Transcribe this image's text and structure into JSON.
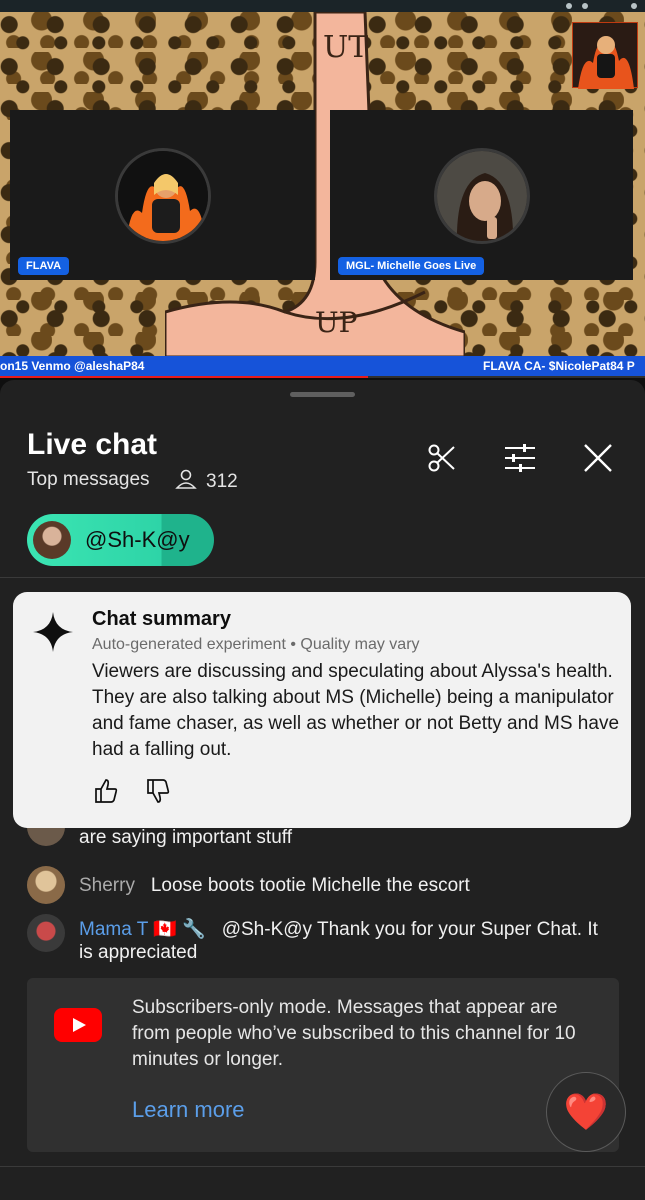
{
  "video": {
    "tiles": [
      {
        "name": "FLAVA"
      },
      {
        "name": "MGL- Michelle Goes Live"
      }
    ],
    "hand_text": {
      "top": "UT",
      "bottom": "UP"
    },
    "ticker_left": "on15 Venmo @aleshaP84",
    "ticker_right": "FLAVA CA- $NicolePat84 P",
    "progress_fraction": 0.57
  },
  "live_chat": {
    "title": "Live chat",
    "filter": "Top messages",
    "viewer_count": "312",
    "icons": [
      "scissors-icon",
      "sliders-icon",
      "close-icon"
    ]
  },
  "pinned": {
    "handle": "@Sh-K@y"
  },
  "summary": {
    "title": "Chat summary",
    "note": "Auto-generated experiment • Quality may vary",
    "body": "Viewers are discussing and speculating about Alyssa's health. They are also talking about MS (Michelle) being a manipulator and fame chaser, as well as whether or not Betty and MS have had a falling out."
  },
  "messages": [
    {
      "author": "",
      "text": "are saying important stuff"
    },
    {
      "author": "Sherry",
      "text": "Loose boots tootie Michelle the escort"
    },
    {
      "author": "Mama T",
      "badges": "🇨🇦 🔧",
      "text": "@Sh-K@y Thank you for your Super Chat. It is appreciated"
    }
  ],
  "notice": {
    "text": "Subscribers-only mode. Messages that appear are from people who’ve subscribed to this channel for 10 minutes or longer.",
    "link": "Learn more"
  },
  "reaction": {
    "emoji": "❤️"
  },
  "colors": {
    "accent": "#3be5b3",
    "link": "#5b9ee9",
    "live_red": "#ff0000",
    "ticker": "#1653d9"
  }
}
